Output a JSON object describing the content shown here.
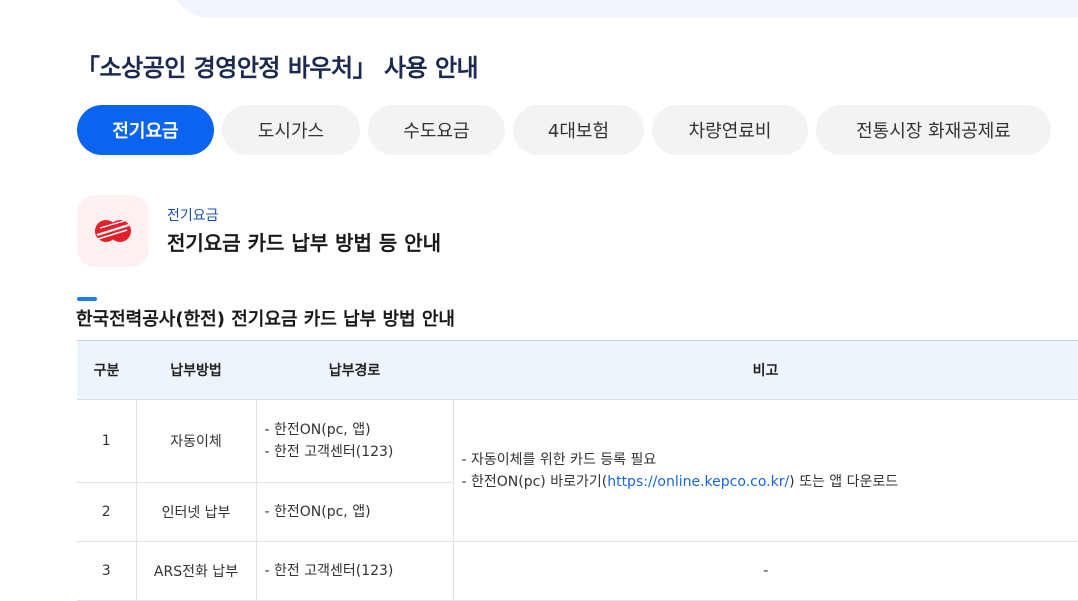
{
  "page": {
    "title": "「소상공인 경영안정 바우처」 사용 안내"
  },
  "tabs": [
    {
      "label": "전기요금",
      "active": true
    },
    {
      "label": "도시가스",
      "active": false
    },
    {
      "label": "수도요금",
      "active": false
    },
    {
      "label": "4대보험",
      "active": false
    },
    {
      "label": "차량연료비",
      "active": false
    },
    {
      "label": "전통시장 화재공제료",
      "active": false
    }
  ],
  "section": {
    "category": "전기요금",
    "title": "전기요금 카드 납부 방법 등 안내",
    "logo_icon": "kepco-logo-icon",
    "table_title": "한국전력공사(한전) 전기요금 카드 납부 방법 안내"
  },
  "table": {
    "headers": [
      "구분",
      "납부방법",
      "납부경로",
      "비고"
    ],
    "rows": [
      {
        "no": "1",
        "method": "자동이체",
        "routes": [
          "- 한전ON(pc, 앱)",
          "- 한전 고객센터(123)"
        ]
      },
      {
        "no": "2",
        "method": "인터넷 납부",
        "routes": [
          "- 한전ON(pc, 앱)"
        ]
      },
      {
        "no": "3",
        "method": "ARS전화 납부",
        "routes": [
          "- 한전 고객센터(123)"
        ],
        "note": "-"
      }
    ],
    "shared_note": {
      "line1": "- 자동이체를 위한 카드 등록 필요",
      "line2_prefix": "- 한전ON(pc) 바로가기(",
      "line2_link": "https://online.kepco.co.kr/",
      "line2_suffix": ") 또는 앱 다운로드"
    }
  },
  "colors": {
    "accent": "#0a64f0",
    "title": "#1b2a4e",
    "link": "#1a66d8",
    "logo_red": "#e4202b"
  }
}
